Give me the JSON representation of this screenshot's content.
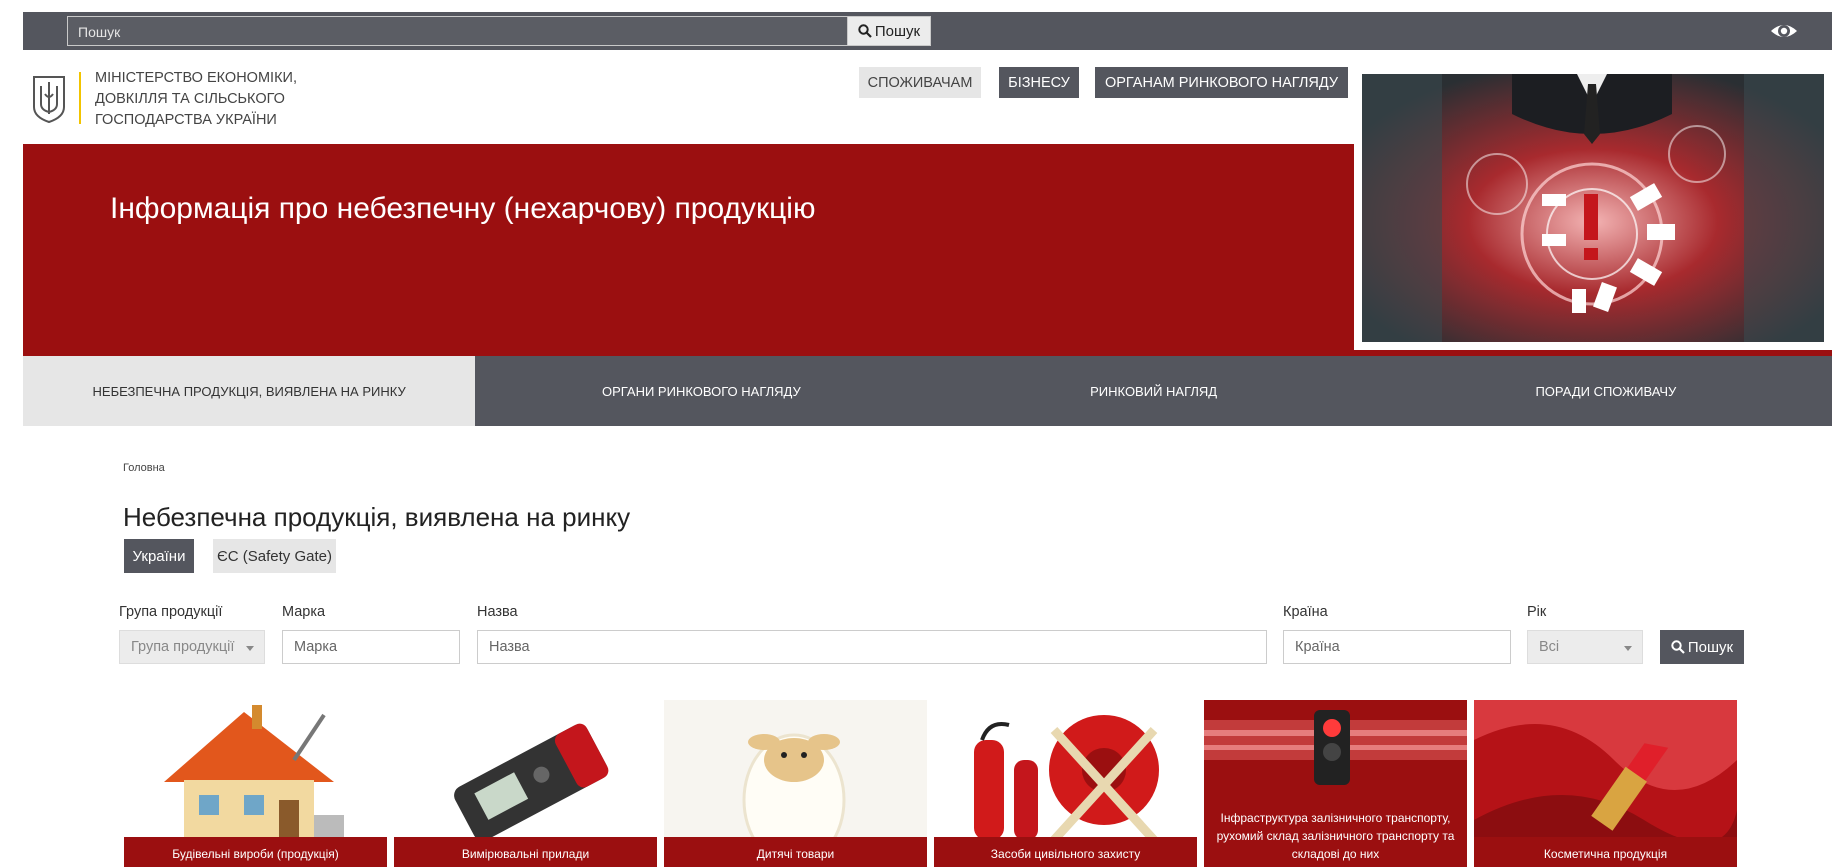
{
  "topbar": {
    "search_placeholder": "Пошук",
    "search_button": "Пошук",
    "accessibility_icon": "eye-icon"
  },
  "header": {
    "ministry_lines": [
      "Міністерство економіки,",
      "довкілля та сільського",
      "господарства України"
    ],
    "logo_icon": "trident-emblem-icon",
    "nav": [
      "Споживачам",
      "Бізнесу",
      "Органам ринкового нагляду"
    ]
  },
  "banner": {
    "title": "Інформація про небезпечну (нехарчову) продукцію"
  },
  "subnav": [
    "Небезпечна продукція, виявлена на ринку",
    "Органи ринкового нагляду",
    "Ринковий нагляд",
    "Поради споживачу"
  ],
  "breadcrumb": "Головна",
  "page_title": "Небезпечна продукція, виявлена на ринку",
  "tabs": [
    "України",
    "ЄС (Safety Gate)"
  ],
  "filters": {
    "group": {
      "label": "Група продукції",
      "placeholder": "Група продукції"
    },
    "brand": {
      "label": "Марка",
      "placeholder": "Марка"
    },
    "name": {
      "label": "Назва",
      "placeholder": "Назва"
    },
    "country": {
      "label": "Країна",
      "placeholder": "Країна"
    },
    "year": {
      "label": "Рік",
      "value": "Всі"
    },
    "search_button": "Пошук"
  },
  "categories": [
    {
      "label": "Будівельні вироби (продукція)",
      "icon": "house-icon"
    },
    {
      "label": "Вимірювальні прилади",
      "icon": "laser-meter-icon"
    },
    {
      "label": "Дитячі товари",
      "icon": "toy-sheep-icon"
    },
    {
      "label": "Засоби цивільного захисту",
      "icon": "fire-extinguisher-icon"
    },
    {
      "label": "Інфраструктура залізничного транспорту, рухомий склад залізничного транспорту та складові до них",
      "icon": "traffic-light-icon"
    },
    {
      "label": "Косметична продукція",
      "icon": "lipstick-icon"
    }
  ],
  "colors": {
    "brand_red": "#9b0f10",
    "dark_gray": "#54565e",
    "light_gray": "#e6e6e6",
    "accent_yellow": "#f2c400"
  }
}
